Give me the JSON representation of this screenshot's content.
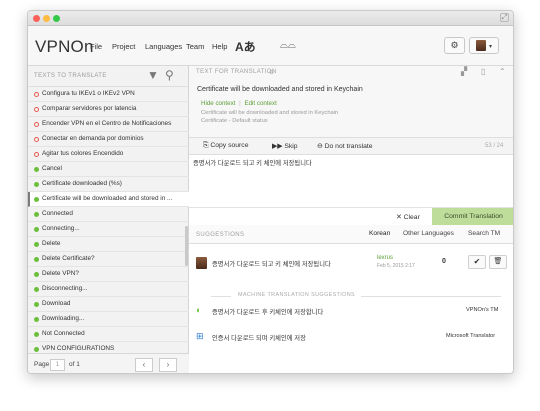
{
  "window": {
    "fullscreen_icon": "fullscreen-icon"
  },
  "toolbar": {
    "brand": "VPNOn",
    "menus": [
      "File",
      "Project",
      "Languages",
      "Team",
      "Help"
    ],
    "translate_icon": "Aあ",
    "glasses_icon": "⌓⌓"
  },
  "left": {
    "header_label": "TEXTS TO TRANSLATE",
    "items": [
      {
        "label": "Configura tu IKEv1 o IKEv2 VPN",
        "status": "untranslated"
      },
      {
        "label": "Comparar servidores por latencia",
        "status": "untranslated"
      },
      {
        "label": "Encender VPN en el Centro de Notificaciones",
        "status": "untranslated"
      },
      {
        "label": "Conectar en demanda por dominios",
        "status": "untranslated"
      },
      {
        "label": "Agitar tus colores Encendido",
        "status": "untranslated"
      },
      {
        "label": "Cancel",
        "status": "translated"
      },
      {
        "label": "Certificate downloaded (%s)",
        "status": "translated"
      },
      {
        "label": "Certificate will be downloaded and stored in ...",
        "status": "translated",
        "selected": true
      },
      {
        "label": "Connected",
        "status": "translated"
      },
      {
        "label": "Connecting...",
        "status": "translated"
      },
      {
        "label": "Delete",
        "status": "translated"
      },
      {
        "label": "Delete Certificate?",
        "status": "translated"
      },
      {
        "label": "Delete VPN?",
        "status": "translated"
      },
      {
        "label": "Disconnecting...",
        "status": "translated"
      },
      {
        "label": "Download",
        "status": "translated"
      },
      {
        "label": "Downloading...",
        "status": "translated"
      },
      {
        "label": "Not Connected",
        "status": "translated"
      },
      {
        "label": "VPN CONFIGURATIONS",
        "status": "translated"
      }
    ],
    "footer": {
      "page_label": "Page",
      "page_value": "1",
      "of_label": "of 1",
      "prev": "‹",
      "next": "›"
    }
  },
  "source": {
    "label": "TEXT FOR TRANSLATION",
    "label_suffix": "⊖",
    "text": "Certificate will be downloaded and stored in Keychain",
    "hide_context": "Hide context",
    "separator": "|",
    "edit_context": "Edit context",
    "context_line1": "Certificate will be downloaded and stored in Keychain",
    "context_line2": "Certificate - Default status"
  },
  "actions": {
    "copy_source": "Copy source",
    "skip": "Skip",
    "do_not_translate": "Do not translate",
    "counter": "53 / 24"
  },
  "editor": {
    "value": "증명서가 다운로드 되고 키 체인에 저장됩니다"
  },
  "commit": {
    "clear": "Clear",
    "commit": "Commit Translation"
  },
  "suggestions": {
    "label": "SUGGESTIONS",
    "tabs": [
      "Korean",
      "Other Languages",
      "Search TM"
    ],
    "tm": {
      "text": "증명서가 다운로드 되고 키 체인에 저장됩니다",
      "user": "lexrus",
      "date": "Feb 5, 2015 2:17",
      "votes": "0",
      "check": "✔",
      "trash": "🗑"
    },
    "mt_label": "MACHINE TRANSLATION SUGGESTIONS",
    "mt": [
      {
        "text": "증명서가 다운로드 후 키체인에 저장합니다",
        "source": "VPNOn's TM"
      },
      {
        "text": "인증서 다운로드 되며 키체인에 저장",
        "source": "Microsoft Translator"
      }
    ]
  }
}
